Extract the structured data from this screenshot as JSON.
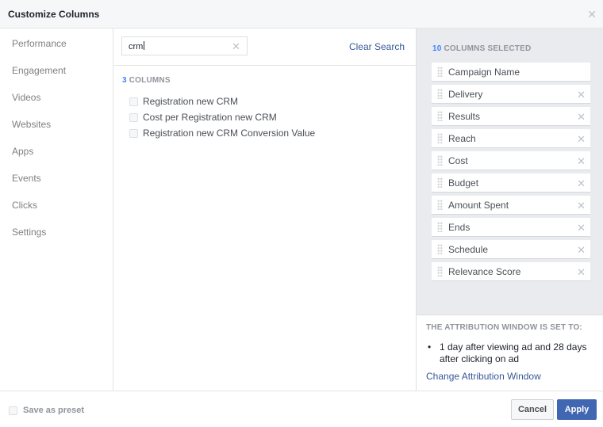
{
  "dialog": {
    "title": "Customize Columns",
    "close_icon": "close-icon"
  },
  "sidebar": {
    "items": [
      {
        "label": "Performance"
      },
      {
        "label": "Engagement"
      },
      {
        "label": "Videos"
      },
      {
        "label": "Websites"
      },
      {
        "label": "Apps"
      },
      {
        "label": "Events"
      },
      {
        "label": "Clicks"
      },
      {
        "label": "Settings"
      }
    ]
  },
  "search": {
    "value": "crm",
    "clear_icon": "clear-icon",
    "clear_search_label": "Clear Search"
  },
  "results": {
    "count": "3",
    "count_suffix": "COLUMNS",
    "columns": [
      {
        "label": "Registration new CRM",
        "checked": false
      },
      {
        "label": "Cost per Registration new CRM",
        "checked": false
      },
      {
        "label": "Registration new CRM Conversion Value",
        "checked": false
      }
    ]
  },
  "selected": {
    "count": "10",
    "count_suffix": "COLUMNS SELECTED",
    "items": [
      {
        "label": "Campaign Name",
        "removable": false
      },
      {
        "label": "Delivery",
        "removable": true
      },
      {
        "label": "Results",
        "removable": true
      },
      {
        "label": "Reach",
        "removable": true
      },
      {
        "label": "Cost",
        "removable": true
      },
      {
        "label": "Budget",
        "removable": true
      },
      {
        "label": "Amount Spent",
        "removable": true
      },
      {
        "label": "Ends",
        "removable": true
      },
      {
        "label": "Schedule",
        "removable": true
      },
      {
        "label": "Relevance Score",
        "removable": true
      }
    ]
  },
  "attribution": {
    "heading": "THE ATTRIBUTION WINDOW IS SET TO:",
    "bullet": "•",
    "description": "1 day after viewing ad and 28 days after clicking on ad",
    "change_link": "Change Attribution Window"
  },
  "footer": {
    "save_preset_label": "Save as preset",
    "save_preset_checked": false,
    "cancel_label": "Cancel",
    "apply_label": "Apply"
  },
  "colors": {
    "accent_blue": "#4080ff",
    "link_blue": "#365899",
    "apply_button": "#4267b2"
  }
}
